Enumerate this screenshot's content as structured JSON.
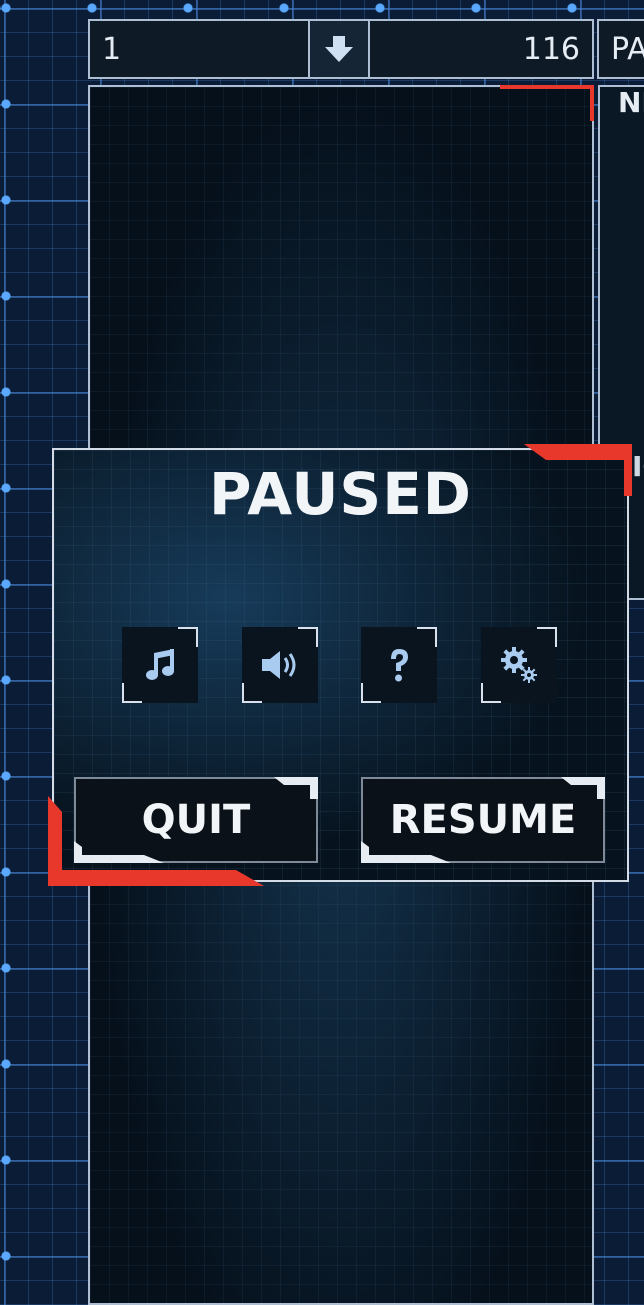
{
  "hud": {
    "level": "1",
    "score": "116",
    "pause_label": "PA"
  },
  "side_panel": {
    "label_top": "NE",
    "label_mid": "IC"
  },
  "pause_dialog": {
    "title": "PAUSED",
    "icons": [
      "music-icon",
      "sound-icon",
      "help-icon",
      "settings-icon"
    ],
    "quit_label": "QUIT",
    "resume_label": "RESUME"
  },
  "colors": {
    "accent_red": "#e8382c",
    "grid_blue": "#4682d2",
    "panel_border": "#aebfd3"
  }
}
